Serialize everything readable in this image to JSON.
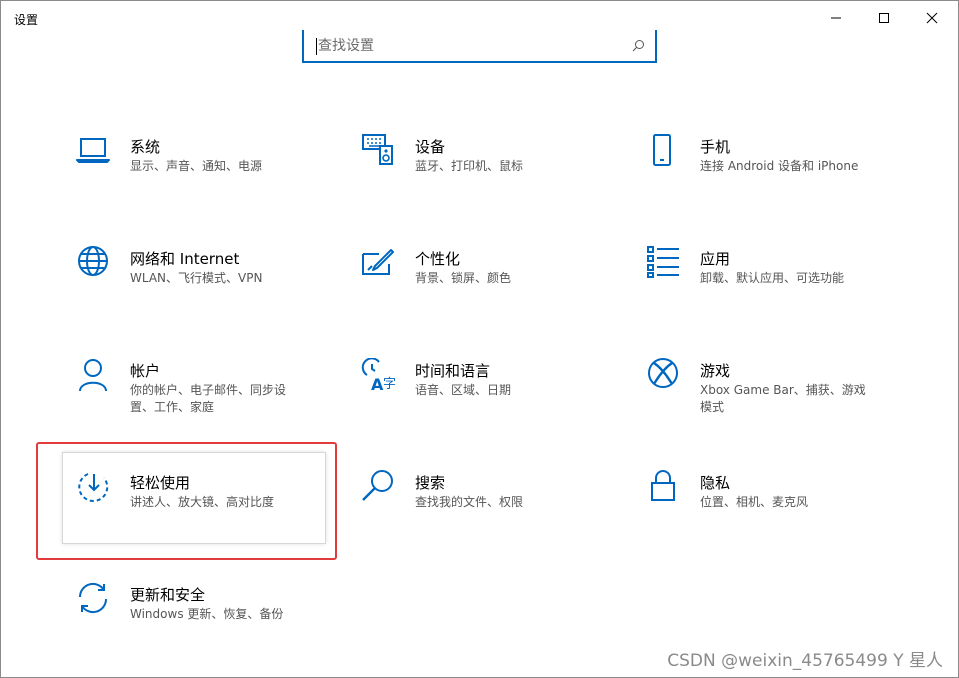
{
  "window": {
    "title": "设置",
    "minimize_icon": "minimize-icon",
    "maximize_icon": "maximize-icon",
    "close_icon": "close-icon"
  },
  "search": {
    "placeholder": "查找设置",
    "value": "",
    "icon": "search-icon"
  },
  "accent_color": "#0067c0",
  "highlight_color": "#e23b3b",
  "tiles": [
    {
      "name": "系统",
      "desc": "显示、声音、通知、电源",
      "icon": "laptop-icon"
    },
    {
      "name": "设备",
      "desc": "蓝牙、打印机、鼠标",
      "icon": "keyboard-speaker-icon"
    },
    {
      "name": "手机",
      "desc": "连接 Android 设备和 iPhone",
      "icon": "phone-icon"
    },
    {
      "name": "网络和 Internet",
      "desc": "WLAN、飞行模式、VPN",
      "icon": "globe-icon"
    },
    {
      "name": "个性化",
      "desc": "背景、锁屏、颜色",
      "icon": "paint-brush-icon"
    },
    {
      "name": "应用",
      "desc": "卸载、默认应用、可选功能",
      "icon": "apps-list-icon"
    },
    {
      "name": "帐户",
      "desc": "你的帐户、电子邮件、同步设\n置、工作、家庭",
      "icon": "person-icon"
    },
    {
      "name": "时间和语言",
      "desc": "语音、区域、日期",
      "icon": "time-language-icon"
    },
    {
      "name": "游戏",
      "desc": "Xbox Game Bar、捕获、游戏\n模式",
      "icon": "xbox-icon"
    },
    {
      "name": "轻松使用",
      "desc": "讲述人、放大镜、高对比度",
      "icon": "ease-of-access-icon"
    },
    {
      "name": "搜索",
      "desc": "查找我的文件、权限",
      "icon": "search-magnifier-icon"
    },
    {
      "name": "隐私",
      "desc": "位置、相机、麦克风",
      "icon": "lock-icon"
    },
    {
      "name": "更新和安全",
      "desc": "Windows 更新、恢复、备份",
      "icon": "sync-arrows-icon"
    }
  ],
  "watermark": "CSDN @weixin_45765499 Y 星人"
}
